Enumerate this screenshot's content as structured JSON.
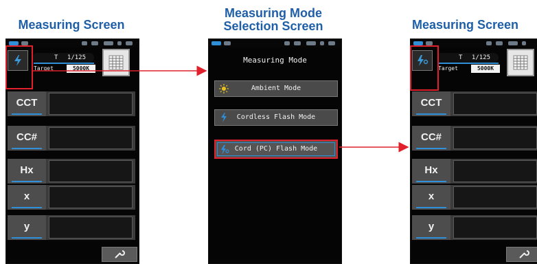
{
  "captions": {
    "left": "Measuring Screen",
    "middle_line1": "Measuring Mode",
    "middle_line2": "Selection Screen",
    "right": "Measuring Screen"
  },
  "left_device": {
    "mode_icon": "flash-icon",
    "shutter_prefix": "T",
    "shutter_value": "1/125",
    "target_label": "Target",
    "target_value": "5000K",
    "rows": [
      "CCT",
      "CC#",
      "Hx",
      "x",
      "y"
    ],
    "settings_icon": "wrench-icon"
  },
  "middle_device": {
    "title": "Measuring Mode",
    "items": [
      {
        "label": "Ambient Mode",
        "icon": "sun-icon"
      },
      {
        "label": "Cordless Flash Mode",
        "icon": "cordless-flash-icon"
      },
      {
        "label": "Cord (PC) Flash Mode",
        "icon": "cord-flash-icon"
      }
    ]
  },
  "right_device": {
    "mode_icon": "cord-flash-icon",
    "shutter_prefix": "T",
    "shutter_value": "1/125",
    "target_label": "Target",
    "target_value": "5000K",
    "rows": [
      "CCT",
      "CC#",
      "Hx",
      "x",
      "y"
    ],
    "settings_icon": "wrench-icon"
  },
  "colors": {
    "caption": "#1f5fa8",
    "highlight": "#e0202a",
    "accent": "#2f8fd8"
  }
}
